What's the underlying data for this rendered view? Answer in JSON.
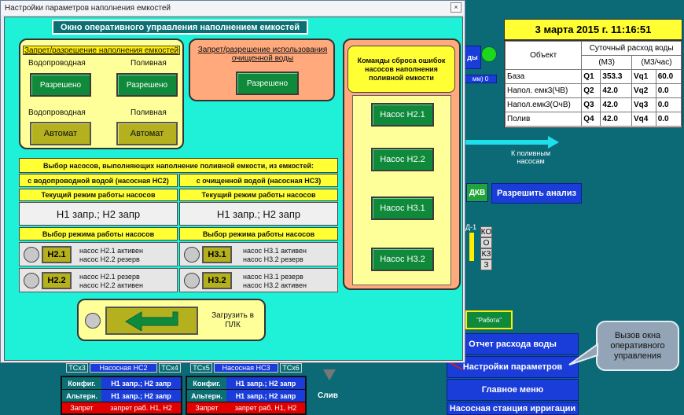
{
  "background": {
    "date": "3 марта 2015 г. 11:16:51",
    "table": {
      "col_object": "Объект",
      "col_daily": "Суточный расход воды",
      "unit_m3": "(М3)",
      "unit_m3h": "(М3/час)",
      "rows": [
        {
          "name": "База",
          "q": "Q1",
          "qv": "353.3",
          "v": "Vq1",
          "vv": "60.0"
        },
        {
          "name": "Напол. емк3(ЧВ)",
          "q": "Q2",
          "qv": "42.0",
          "v": "Vq2",
          "vv": "0.0"
        },
        {
          "name": "Напол.емк3(ОчВ)",
          "q": "Q3",
          "qv": "42.0",
          "v": "Vq3",
          "vv": "0.0"
        },
        {
          "name": "Полив",
          "q": "Q4",
          "qv": "42.0",
          "v": "Vq4",
          "vv": "0.0"
        }
      ]
    },
    "frag_dy": "ды",
    "frag_mm": "мм) 0",
    "to_pumps": "К поливным насосам",
    "dkv": "ДКВ",
    "allow_analysis": "Разрешить анализ",
    "d1": "Д-1",
    "sq_labels": [
      "КО",
      "О",
      "КЗ",
      "З"
    ],
    "work_status": "\"Работа\"",
    "btn_report": "Отчет расхода воды",
    "btn_settings": "Настройки параметров",
    "btn_menu": "Главное меню",
    "btn_irrigation": "Насосная станция ирригации",
    "callout": "Вызов окна оперативного управления",
    "drain": "Слив",
    "tcs_left": [
      "ТСх3",
      "Насосная НС2",
      "ТСх4"
    ],
    "tcs_right": [
      "ТСх5",
      "Насосная НС3",
      "ТСх6"
    ],
    "bottom_rows_left": [
      {
        "label": "Конфиг.",
        "value": "Н1 запр.; Н2 запр"
      },
      {
        "label": "Альтерн.",
        "value": "Н1 запр.; Н2 запр"
      },
      {
        "label": "Запрет",
        "value": "запрет раб. Н1, Н2"
      }
    ],
    "bottom_rows_right": [
      {
        "label": "Конфиг.",
        "value": "Н1 запр.; Н2 запр"
      },
      {
        "label": "Альтерн.",
        "value": "Н1 запр.; Н2 запр"
      },
      {
        "label": "Запрет",
        "value": "запрет раб. Н1, Н2"
      }
    ]
  },
  "dialog": {
    "title": "Настройки параметров наполнения емкостей",
    "close": "×",
    "header": "Окно оперативного управления наполнением емкостей",
    "fill_permission": {
      "title": "Запрет/разрешение наполнения емкостей",
      "col1": "Водопроводная",
      "col2": "Поливная",
      "btn1": "Разрешено",
      "btn2": "Разрешено",
      "col3": "Водопроводная",
      "col4": "Поливная",
      "auto1": "Автомат",
      "auto2": "Автомат"
    },
    "clean_permission": {
      "title": "Запрет/разрешение использования очищенной воды",
      "btn": "Разрешено"
    },
    "reset": {
      "title": "Команды сброса ошибок насосов наполнения поливной емкости",
      "buttons": [
        "Насос Н2.1",
        "Насос Н2.2",
        "Насос Н3.1",
        "Насос Н3.2"
      ]
    },
    "selection": {
      "title": "Выбор насосов, выполняющих наполнение поливной емкости, из емкостей:",
      "left_src": "с водопроводной водой (насосная НС2)",
      "right_src": "с очищенной водой (насосная НС3)",
      "cur_mode": "Текущий режим работы насосов",
      "left_mode": "Н1 запр.; Н2 запр",
      "right_mode": "Н1 запр.; Н2 запр",
      "select_mode": "Выбор режима работы насосов",
      "left_opts": [
        {
          "btn": "Н2.1",
          "l1": "насос Н2.1 активен",
          "l2": "насос Н2.2 резерв"
        },
        {
          "btn": "Н2.2",
          "l1": "насос Н2.1 резерв",
          "l2": "насос Н2.2 активен"
        }
      ],
      "right_opts": [
        {
          "btn": "Н3.1",
          "l1": "насос Н3.1 активен",
          "l2": "насос Н3.2 резерв"
        },
        {
          "btn": "Н3.2",
          "l1": "насос Н3.1 резерв",
          "l2": "насос Н3.2 активен"
        }
      ]
    },
    "load": "Загрузить в ПЛК"
  },
  "colors": {
    "accent_cyan": "#1ff0d8",
    "header_teal": "#0b6f74",
    "green_btn": "#0e8a3a",
    "olive_btn": "#b4b01e",
    "arrow_red": "#cc2222"
  }
}
